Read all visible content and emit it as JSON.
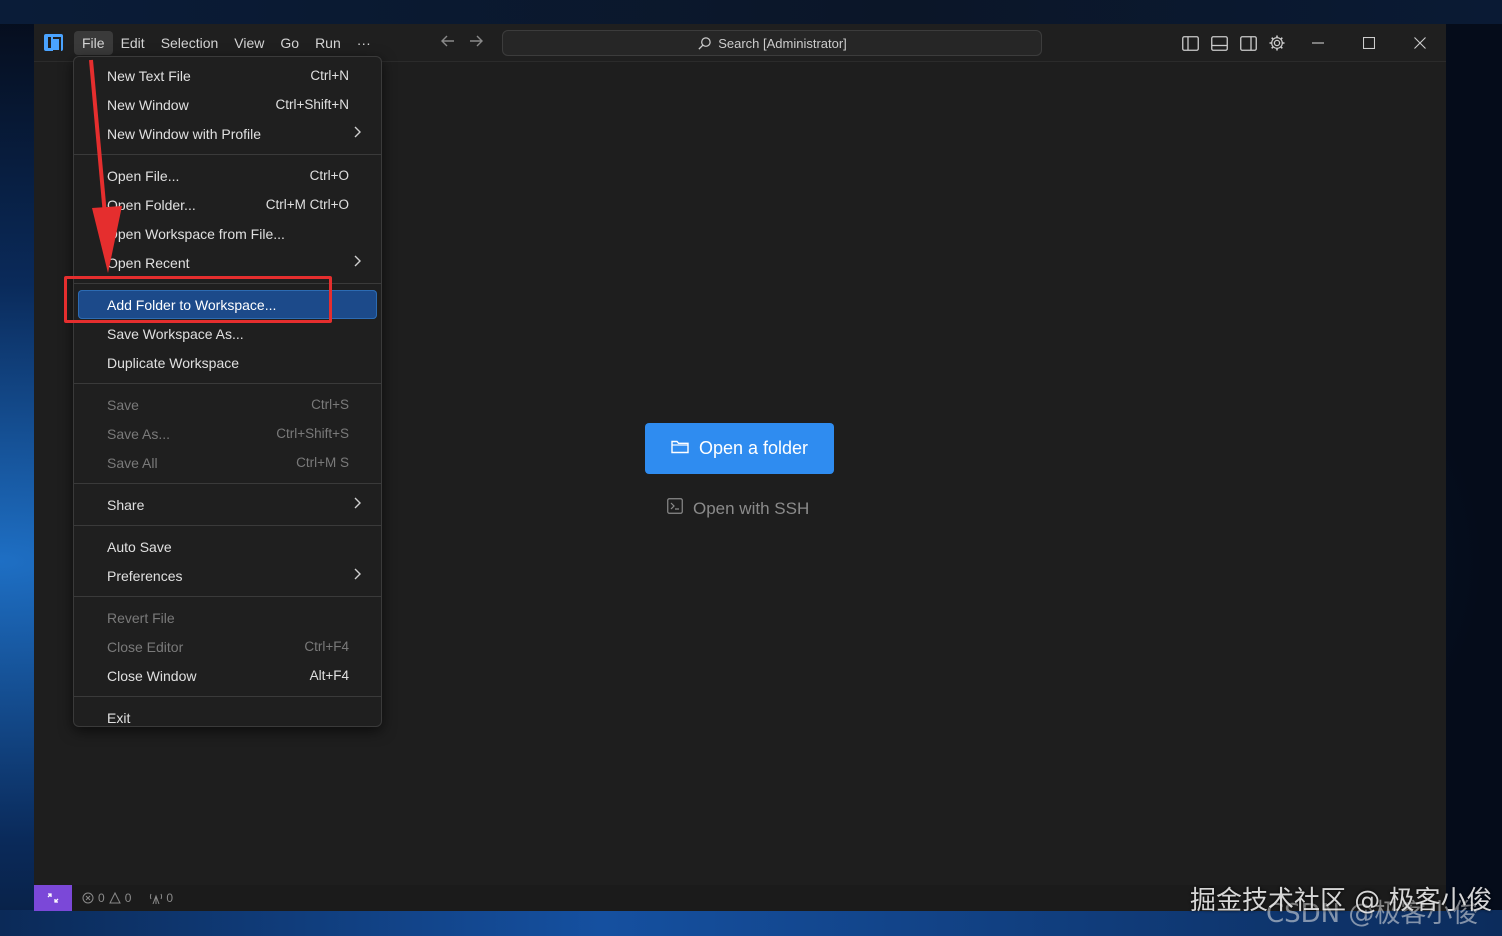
{
  "menubar": {
    "items": [
      "File",
      "Edit",
      "Selection",
      "View",
      "Go",
      "Run",
      "···"
    ],
    "active": "File"
  },
  "search": {
    "label": "Search [Administrator]"
  },
  "file_menu": {
    "groups": [
      [
        {
          "label": "New Text File",
          "shortcut": "Ctrl+N"
        },
        {
          "label": "New Window",
          "shortcut": "Ctrl+Shift+N"
        },
        {
          "label": "New Window with Profile",
          "submenu": true
        }
      ],
      [
        {
          "label": "Open File...",
          "shortcut": "Ctrl+O"
        },
        {
          "label": "Open Folder...",
          "shortcut": "Ctrl+M Ctrl+O"
        },
        {
          "label": "Open Workspace from File..."
        },
        {
          "label": "Open Recent",
          "submenu": true
        }
      ],
      [
        {
          "label": "Add Folder to Workspace...",
          "highlight": true
        },
        {
          "label": "Save Workspace As..."
        },
        {
          "label": "Duplicate Workspace"
        }
      ],
      [
        {
          "label": "Save",
          "shortcut": "Ctrl+S",
          "disabled": true
        },
        {
          "label": "Save As...",
          "shortcut": "Ctrl+Shift+S",
          "disabled": true
        },
        {
          "label": "Save All",
          "shortcut": "Ctrl+M S",
          "disabled": true
        }
      ],
      [
        {
          "label": "Share",
          "submenu": true
        }
      ],
      [
        {
          "label": "Auto Save"
        },
        {
          "label": "Preferences",
          "submenu": true
        }
      ],
      [
        {
          "label": "Revert File",
          "disabled": true
        },
        {
          "label": "Close Editor",
          "shortcut": "Ctrl+F4",
          "disabled": true
        },
        {
          "label": "Close Window",
          "shortcut": "Alt+F4"
        }
      ],
      [
        {
          "label": "Exit"
        }
      ]
    ]
  },
  "welcome": {
    "open_folder_label": "Open a folder",
    "ssh_label": "Open with SSH"
  },
  "statusbar": {
    "errors": "0",
    "warnings": "0",
    "ports": "0"
  },
  "watermark": {
    "line1": "掘金技术社区 @ 极客小俊",
    "line2": "CSDN @极客小俊"
  },
  "colors": {
    "accent": "#2f8cf0",
    "highlight": "#1c4a8a",
    "annotation_red": "#e52e2e",
    "remote": "#7b48d8"
  }
}
